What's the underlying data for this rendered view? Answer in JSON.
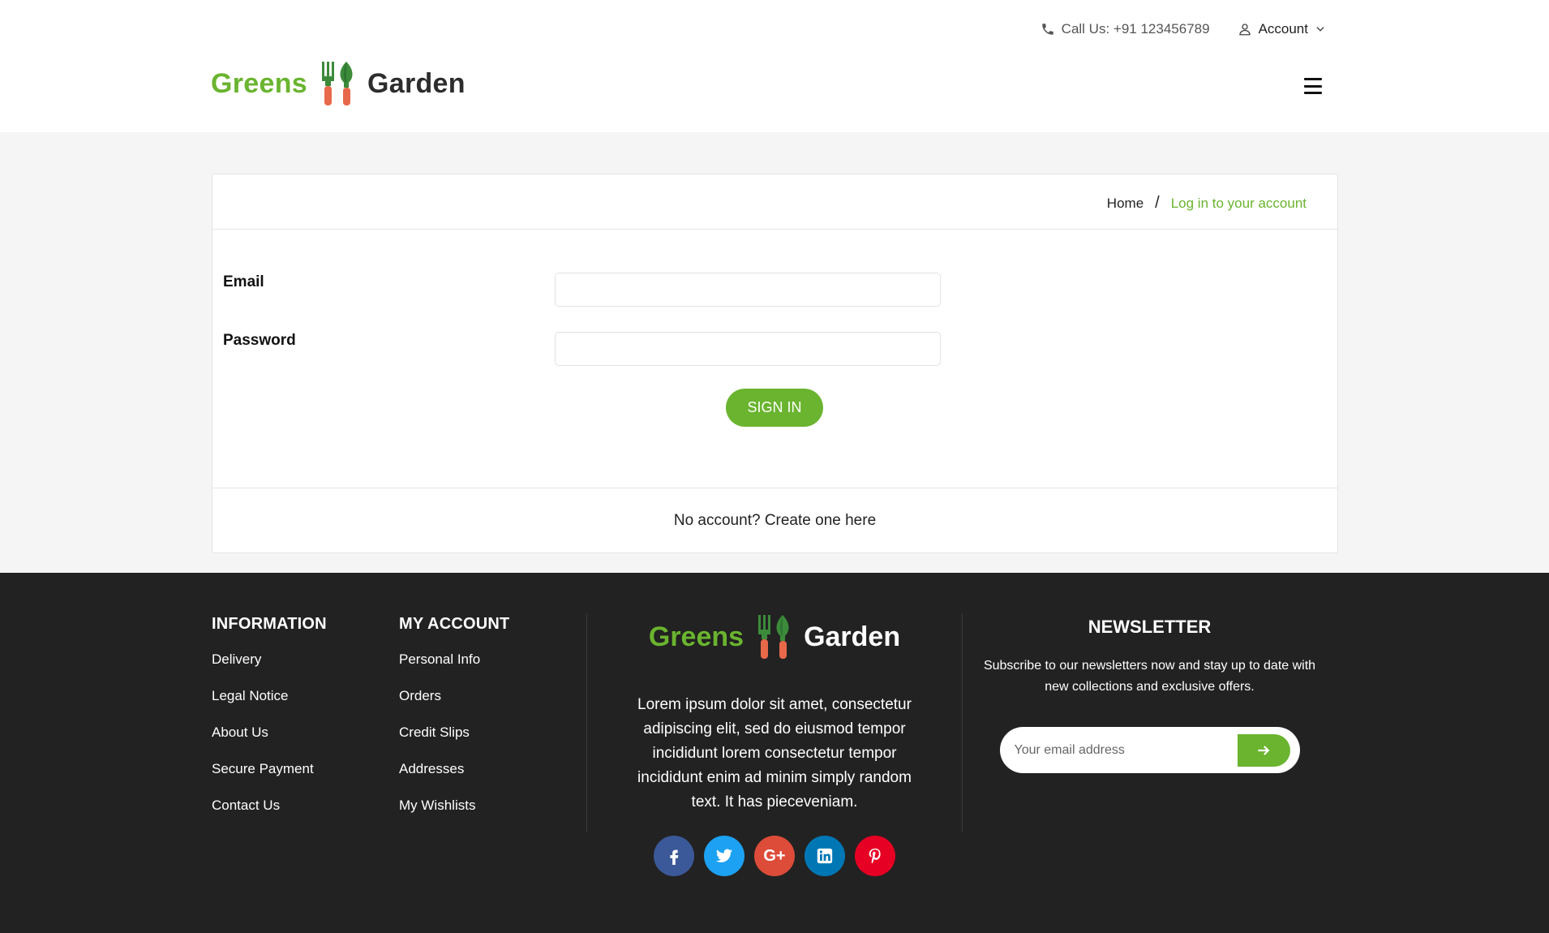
{
  "header": {
    "call_text": "Call Us: +91 123456789",
    "account_label": "Account",
    "logo": {
      "part1": "Greens",
      "part2": "Garden"
    }
  },
  "breadcrumb": {
    "home": "Home",
    "separator": "/",
    "current": "Log in to your account"
  },
  "login_form": {
    "email_label": "Email",
    "email_value": "",
    "password_label": "Password",
    "password_value": "",
    "submit_label": "SIGN IN",
    "no_account_text": "No account? Create one here"
  },
  "footer": {
    "information": {
      "title": "INFORMATION",
      "items": [
        "Delivery",
        "Legal Notice",
        "About Us",
        "Secure Payment",
        "Contact Us"
      ]
    },
    "my_account": {
      "title": "MY ACCOUNT",
      "items": [
        "Personal Info",
        "Orders",
        "Credit Slips",
        "Addresses",
        "My Wishlists"
      ]
    },
    "logo": {
      "part1": "Greens",
      "part2": "Garden"
    },
    "description": "Lorem ipsum dolor sit amet, consectetur adipiscing elit, sed do eiusmod tempor incididunt lorem consectetur tempor incididunt enim ad minim simply random text. It has pieceveniam.",
    "social": [
      {
        "icon": "facebook-icon",
        "color": "#3b5998"
      },
      {
        "icon": "twitter-icon",
        "color": "#1da1f2"
      },
      {
        "icon": "google-plus-icon",
        "color": "#dd4b39"
      },
      {
        "icon": "linkedin-icon",
        "color": "#0077b5"
      },
      {
        "icon": "pinterest-icon",
        "color": "#e60023"
      }
    ],
    "newsletter": {
      "title": "NEWSLETTER",
      "text": "Subscribe to our newsletters now and stay up to date with new collections and exclusive offers.",
      "placeholder": "Your email address"
    }
  },
  "colors": {
    "accent": "#6ab42f",
    "footer_bg": "#222222",
    "page_bg": "#f5f5f5"
  }
}
